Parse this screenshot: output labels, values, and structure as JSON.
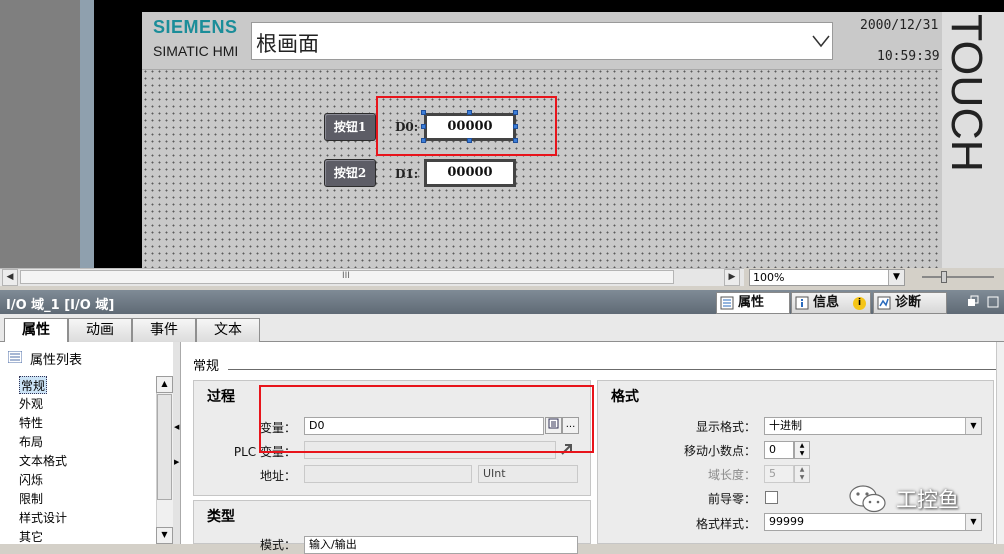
{
  "hmi": {
    "logo_brand": "SIEMENS",
    "logo_product": "SIMATIC HMI",
    "screen_name": "根画面",
    "date": "2000/12/31",
    "time": "10:59:39",
    "panel_text": "TOUCH",
    "buttons": [
      {
        "label": "按钮1"
      },
      {
        "label": "按钮2"
      }
    ],
    "io_labels": [
      "D0:",
      "D1:"
    ],
    "io_values": [
      "00000",
      "00000"
    ]
  },
  "editor": {
    "zoom": "100%",
    "scroll_grip": "III"
  },
  "inspector": {
    "title": "I/O 域_1 [I/O 域]",
    "tabs": [
      {
        "label": "属性"
      },
      {
        "label": "信息"
      },
      {
        "label": "诊断"
      }
    ],
    "info_badge": "i",
    "subtabs": [
      "属性",
      "动画",
      "事件",
      "文本"
    ],
    "nav_header": "属性列表",
    "nav_items": [
      "常规",
      "外观",
      "特性",
      "布局",
      "文本格式",
      "闪烁",
      "限制",
      "样式设计",
      "其它"
    ],
    "section_title": "常规",
    "process": {
      "title": "过程",
      "variable_label": "变量：",
      "variable_value": "D0",
      "plc_variable_label": "PLC 变量：",
      "plc_variable_value": "",
      "address_label": "地址：",
      "address_value": "",
      "address_type": "UInt",
      "browse_btn": "..."
    },
    "type": {
      "title": "类型",
      "mode_label": "模式：",
      "mode_value": "输入/输出"
    },
    "format": {
      "title": "格式",
      "display_format_label": "显示格式：",
      "display_format_value": "十进制",
      "decimal_places_label": "移动小数点：",
      "decimal_places_value": "0",
      "field_length_label": "域长度：",
      "field_length_value": "5",
      "leading_zeros_label": "前导零：",
      "format_pattern_label": "格式样式：",
      "format_pattern_value": "99999"
    }
  },
  "watermark": "工控鱼",
  "colors": {
    "siemens_teal": "#1b8d99",
    "highlight_red": "#e8141b",
    "selection_handle": "#3b7dd8",
    "title_bar": "#6b7782"
  }
}
